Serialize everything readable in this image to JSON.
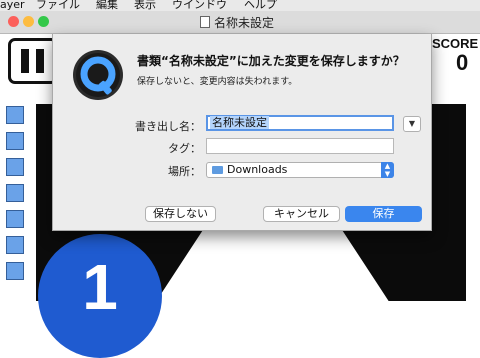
{
  "menubar": {
    "items": [
      "ayer",
      "ファイル",
      "編集",
      "表示",
      "ウインドウ",
      "ヘルプ"
    ]
  },
  "window": {
    "title": "名称未設定",
    "traffic_lights": {
      "close": "#fc605b",
      "minimize": "#fdbc40",
      "zoom": "#34c84a"
    }
  },
  "game": {
    "pause_icon": "pause-icon",
    "score_label": "SCORE",
    "score_value": "0",
    "ball_number": "1",
    "colors": {
      "ball": "#1f5bd0",
      "track": "#0b0b0b",
      "tile": "#6aa2e8"
    }
  },
  "dialog": {
    "app_icon": "quicktime-icon",
    "heading": "書類“名称未設定”に加えた変更を保存しますか？",
    "subtext": "保存しないと、変更内容は失われます。",
    "save_as_label": "書き出し名：",
    "save_as_value": "名称未設定",
    "tags_label": "タグ：",
    "tags_value": "",
    "location_label": "場所：",
    "location_value": "Downloads",
    "location_icon": "folder-icon",
    "buttons": {
      "dont_save": "保存しない",
      "cancel": "キャンセル",
      "save": "保存"
    },
    "accent": "#3a86ee"
  }
}
